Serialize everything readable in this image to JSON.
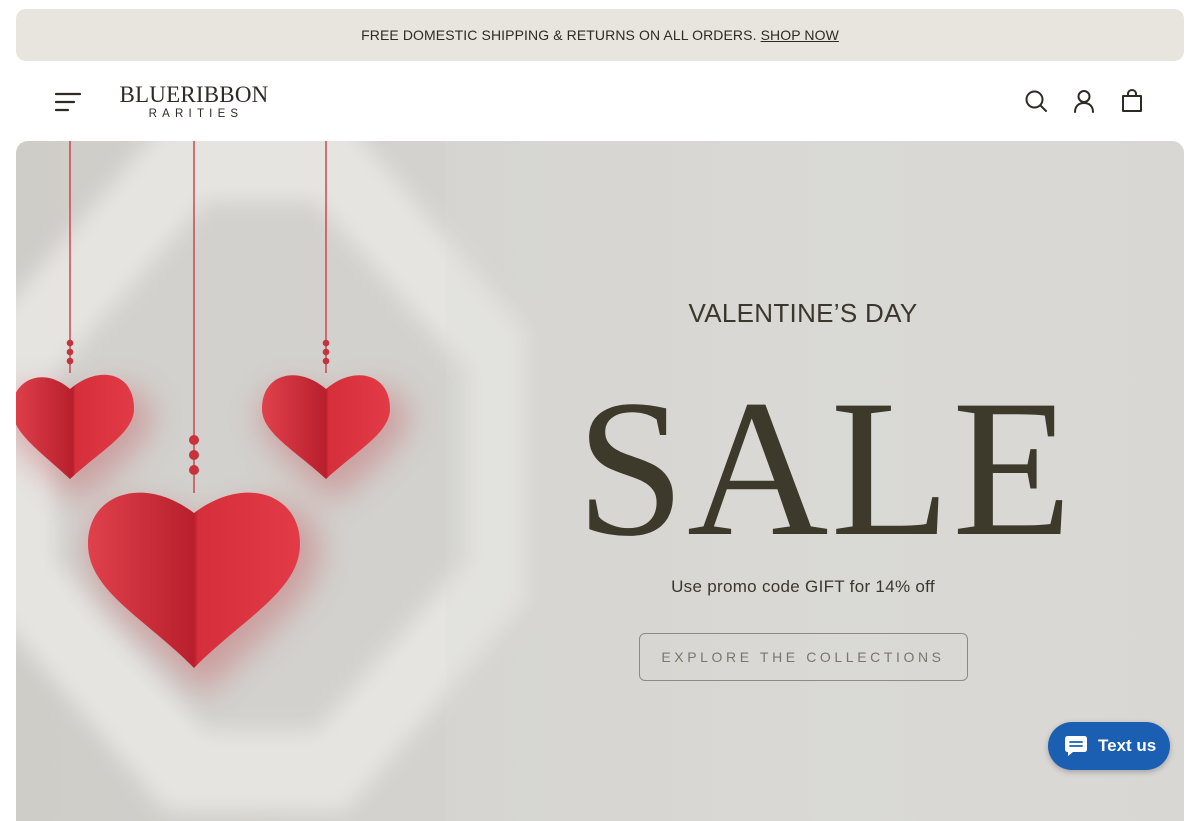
{
  "announcement": {
    "message": "FREE DOMESTIC SHIPPING & RETURNS ON ALL ORDERS.",
    "link_label": "SHOP NOW"
  },
  "header": {
    "logo_line1": "BLUERIBBON",
    "logo_line2": "RARITIES",
    "icons": [
      "menu-icon",
      "search-icon",
      "account-icon",
      "bag-icon"
    ]
  },
  "hero": {
    "eyebrow": "VALENTINE’S DAY",
    "headline": "SALE",
    "promo": "Use promo code GIFT for 14% off",
    "cta_label": "EXPLORE THE COLLECTIONS"
  },
  "chat": {
    "label": "Text us",
    "icon": "chat-bubble-icon",
    "color": "#1b5fb3"
  },
  "colors": {
    "announcement_bg": "#e8e5df",
    "hero_bg": "#d6d4d0",
    "heart_red": "#d62f3c",
    "text_dark": "#3d3a2c"
  }
}
